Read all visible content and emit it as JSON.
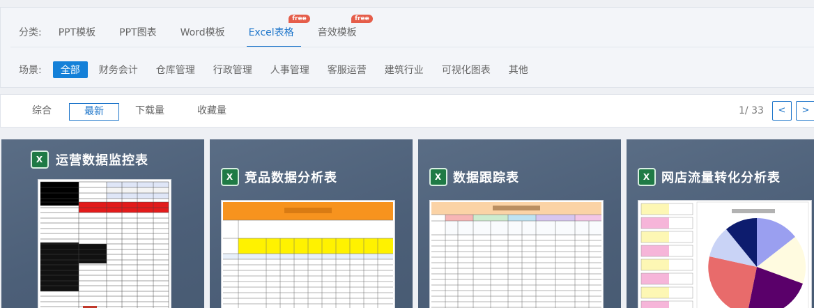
{
  "categories": {
    "label": "分类:",
    "items": [
      {
        "label": "PPT模板",
        "active": false,
        "badge": ""
      },
      {
        "label": "PPT图表",
        "active": false,
        "badge": ""
      },
      {
        "label": "Word模板",
        "active": false,
        "badge": ""
      },
      {
        "label": "Excel表格",
        "active": true,
        "badge": "free"
      },
      {
        "label": "音效模板",
        "active": false,
        "badge": "free"
      }
    ]
  },
  "scenes": {
    "label": "场景:",
    "items": [
      {
        "label": "全部",
        "active": true
      },
      {
        "label": "财务会计",
        "active": false
      },
      {
        "label": "仓库管理",
        "active": false
      },
      {
        "label": "行政管理",
        "active": false
      },
      {
        "label": "人事管理",
        "active": false
      },
      {
        "label": "客服运营",
        "active": false
      },
      {
        "label": "建筑行业",
        "active": false
      },
      {
        "label": "可视化图表",
        "active": false
      },
      {
        "label": "其他",
        "active": false
      }
    ]
  },
  "sort": {
    "items": [
      {
        "label": "综合",
        "active": false
      },
      {
        "label": "最新",
        "active": true
      },
      {
        "label": "下载量",
        "active": false
      },
      {
        "label": "收藏量",
        "active": false
      }
    ]
  },
  "pager": {
    "text": "1/ 33",
    "prev": "<",
    "next": ">"
  },
  "cards": [
    {
      "title": "运营数据监控表",
      "icon": "excel-icon"
    },
    {
      "title": "竞品数据分析表",
      "icon": "excel-icon"
    },
    {
      "title": "数据跟踪表",
      "icon": "excel-icon"
    },
    {
      "title": "网店流量转化分析表",
      "icon": "excel-icon"
    }
  ],
  "colors": {
    "accent": "#1a73c9",
    "badge": "#e55d4a",
    "card_bg": "#52657e",
    "excel_green": "#1f7a45"
  }
}
